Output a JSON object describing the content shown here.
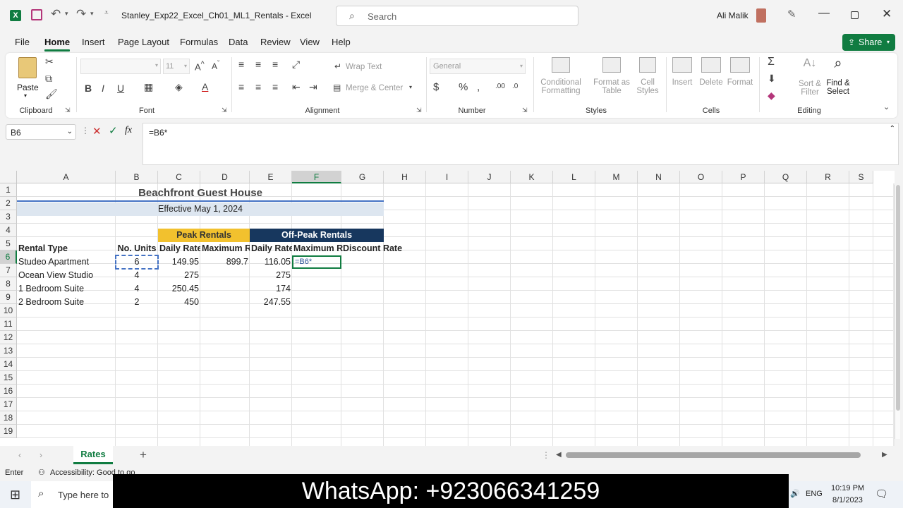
{
  "titlebar": {
    "doc_title": "Stanley_Exp22_Excel_Ch01_ML1_Rentals  -  Excel",
    "search_placeholder": "Search",
    "user": "Ali Malik"
  },
  "tabs": [
    "File",
    "Home",
    "Insert",
    "Page Layout",
    "Formulas",
    "Data",
    "Review",
    "View",
    "Help"
  ],
  "share_label": "Share",
  "ribbon": {
    "clipboard": {
      "label": "Clipboard",
      "paste": "Paste"
    },
    "font": {
      "label": "Font",
      "size": "11",
      "bold": "B",
      "italic": "I",
      "underline": "U"
    },
    "alignment": {
      "label": "Alignment",
      "wrap": "Wrap Text",
      "merge": "Merge & Center"
    },
    "number": {
      "label": "Number",
      "format": "General",
      "currency": "$",
      "percent": "%"
    },
    "styles": {
      "label": "Styles",
      "cond": "Conditional",
      "cond2": "Formatting",
      "fmt_table": "Format as",
      "fmt_table2": "Table",
      "cell_styles": "Cell",
      "cell_styles2": "Styles"
    },
    "cells": {
      "label": "Cells",
      "insert": "Insert",
      "delete": "Delete",
      "format": "Format"
    },
    "editing": {
      "label": "Editing",
      "sort": "Sort &",
      "sort2": "Filter",
      "find": "Find &",
      "find2": "Select"
    }
  },
  "formula_bar": {
    "name_box": "B6",
    "formula": "=B6*"
  },
  "columns": [
    "A",
    "B",
    "C",
    "D",
    "E",
    "F",
    "G",
    "H",
    "I",
    "J",
    "K",
    "L",
    "M",
    "N",
    "O",
    "P",
    "Q",
    "R",
    "S"
  ],
  "rows": [
    "1",
    "2",
    "3",
    "4",
    "5",
    "6",
    "7",
    "8",
    "9",
    "10",
    "11",
    "12",
    "13",
    "14",
    "15",
    "16",
    "17",
    "18",
    "19"
  ],
  "sheet": {
    "title": "Beachfront Guest House",
    "subtitle": "Effective May 1, 2024",
    "peak": "Peak Rentals",
    "offpeak": "Off-Peak Rentals",
    "headers": [
      "Rental Type",
      "No. Units",
      "Daily Rate",
      "Maximum R",
      "Daily Rate",
      "Maximum R",
      "Discount Rate"
    ],
    "data": [
      [
        "Studeo Apartment",
        "6",
        "149.95",
        "899.7",
        "116.05",
        "=B6*"
      ],
      [
        "Ocean View Studio",
        "4",
        "275",
        "",
        "275",
        ""
      ],
      [
        "1 Bedroom Suite",
        "4",
        "250.45",
        "",
        "174",
        ""
      ],
      [
        "2 Bedroom Suite",
        "2",
        "450",
        "",
        "247.55",
        ""
      ]
    ]
  },
  "sheet_tab": "Rates",
  "status": {
    "mode": "Enter",
    "accessibility": "Accessibility: Good to go"
  },
  "taskbar": {
    "search": "Type here to",
    "time": "10:19 PM",
    "date": "8/1/2023",
    "lang": "ENG"
  },
  "banner": "WhatsApp: +923066341259",
  "colors": {
    "excel_green": "#107c41",
    "peak_fill": "#f2c12e",
    "offpeak_fill": "#17375e",
    "subtitle_fill": "#dde6f0",
    "title_rule": "#4472c4"
  }
}
